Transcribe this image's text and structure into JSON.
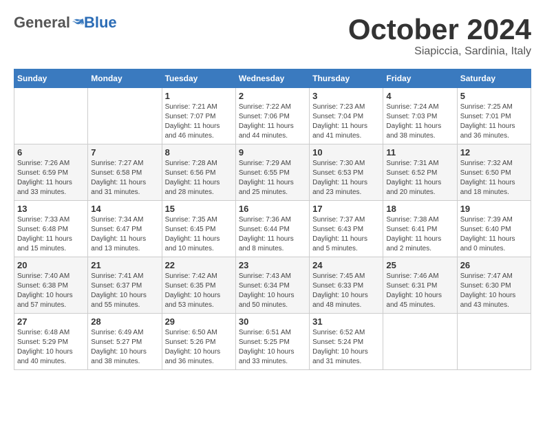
{
  "logo": {
    "general": "General",
    "blue": "Blue"
  },
  "title": "October 2024",
  "subtitle": "Siapiccia, Sardinia, Italy",
  "days_of_week": [
    "Sunday",
    "Monday",
    "Tuesday",
    "Wednesday",
    "Thursday",
    "Friday",
    "Saturday"
  ],
  "weeks": [
    [
      {
        "num": "",
        "info": ""
      },
      {
        "num": "",
        "info": ""
      },
      {
        "num": "1",
        "info": "Sunrise: 7:21 AM\nSunset: 7:07 PM\nDaylight: 11 hours and 46 minutes."
      },
      {
        "num": "2",
        "info": "Sunrise: 7:22 AM\nSunset: 7:06 PM\nDaylight: 11 hours and 44 minutes."
      },
      {
        "num": "3",
        "info": "Sunrise: 7:23 AM\nSunset: 7:04 PM\nDaylight: 11 hours and 41 minutes."
      },
      {
        "num": "4",
        "info": "Sunrise: 7:24 AM\nSunset: 7:03 PM\nDaylight: 11 hours and 38 minutes."
      },
      {
        "num": "5",
        "info": "Sunrise: 7:25 AM\nSunset: 7:01 PM\nDaylight: 11 hours and 36 minutes."
      }
    ],
    [
      {
        "num": "6",
        "info": "Sunrise: 7:26 AM\nSunset: 6:59 PM\nDaylight: 11 hours and 33 minutes."
      },
      {
        "num": "7",
        "info": "Sunrise: 7:27 AM\nSunset: 6:58 PM\nDaylight: 11 hours and 31 minutes."
      },
      {
        "num": "8",
        "info": "Sunrise: 7:28 AM\nSunset: 6:56 PM\nDaylight: 11 hours and 28 minutes."
      },
      {
        "num": "9",
        "info": "Sunrise: 7:29 AM\nSunset: 6:55 PM\nDaylight: 11 hours and 25 minutes."
      },
      {
        "num": "10",
        "info": "Sunrise: 7:30 AM\nSunset: 6:53 PM\nDaylight: 11 hours and 23 minutes."
      },
      {
        "num": "11",
        "info": "Sunrise: 7:31 AM\nSunset: 6:52 PM\nDaylight: 11 hours and 20 minutes."
      },
      {
        "num": "12",
        "info": "Sunrise: 7:32 AM\nSunset: 6:50 PM\nDaylight: 11 hours and 18 minutes."
      }
    ],
    [
      {
        "num": "13",
        "info": "Sunrise: 7:33 AM\nSunset: 6:48 PM\nDaylight: 11 hours and 15 minutes."
      },
      {
        "num": "14",
        "info": "Sunrise: 7:34 AM\nSunset: 6:47 PM\nDaylight: 11 hours and 13 minutes."
      },
      {
        "num": "15",
        "info": "Sunrise: 7:35 AM\nSunset: 6:45 PM\nDaylight: 11 hours and 10 minutes."
      },
      {
        "num": "16",
        "info": "Sunrise: 7:36 AM\nSunset: 6:44 PM\nDaylight: 11 hours and 8 minutes."
      },
      {
        "num": "17",
        "info": "Sunrise: 7:37 AM\nSunset: 6:43 PM\nDaylight: 11 hours and 5 minutes."
      },
      {
        "num": "18",
        "info": "Sunrise: 7:38 AM\nSunset: 6:41 PM\nDaylight: 11 hours and 2 minutes."
      },
      {
        "num": "19",
        "info": "Sunrise: 7:39 AM\nSunset: 6:40 PM\nDaylight: 11 hours and 0 minutes."
      }
    ],
    [
      {
        "num": "20",
        "info": "Sunrise: 7:40 AM\nSunset: 6:38 PM\nDaylight: 10 hours and 57 minutes."
      },
      {
        "num": "21",
        "info": "Sunrise: 7:41 AM\nSunset: 6:37 PM\nDaylight: 10 hours and 55 minutes."
      },
      {
        "num": "22",
        "info": "Sunrise: 7:42 AM\nSunset: 6:35 PM\nDaylight: 10 hours and 53 minutes."
      },
      {
        "num": "23",
        "info": "Sunrise: 7:43 AM\nSunset: 6:34 PM\nDaylight: 10 hours and 50 minutes."
      },
      {
        "num": "24",
        "info": "Sunrise: 7:45 AM\nSunset: 6:33 PM\nDaylight: 10 hours and 48 minutes."
      },
      {
        "num": "25",
        "info": "Sunrise: 7:46 AM\nSunset: 6:31 PM\nDaylight: 10 hours and 45 minutes."
      },
      {
        "num": "26",
        "info": "Sunrise: 7:47 AM\nSunset: 6:30 PM\nDaylight: 10 hours and 43 minutes."
      }
    ],
    [
      {
        "num": "27",
        "info": "Sunrise: 6:48 AM\nSunset: 5:29 PM\nDaylight: 10 hours and 40 minutes."
      },
      {
        "num": "28",
        "info": "Sunrise: 6:49 AM\nSunset: 5:27 PM\nDaylight: 10 hours and 38 minutes."
      },
      {
        "num": "29",
        "info": "Sunrise: 6:50 AM\nSunset: 5:26 PM\nDaylight: 10 hours and 36 minutes."
      },
      {
        "num": "30",
        "info": "Sunrise: 6:51 AM\nSunset: 5:25 PM\nDaylight: 10 hours and 33 minutes."
      },
      {
        "num": "31",
        "info": "Sunrise: 6:52 AM\nSunset: 5:24 PM\nDaylight: 10 hours and 31 minutes."
      },
      {
        "num": "",
        "info": ""
      },
      {
        "num": "",
        "info": ""
      }
    ]
  ]
}
